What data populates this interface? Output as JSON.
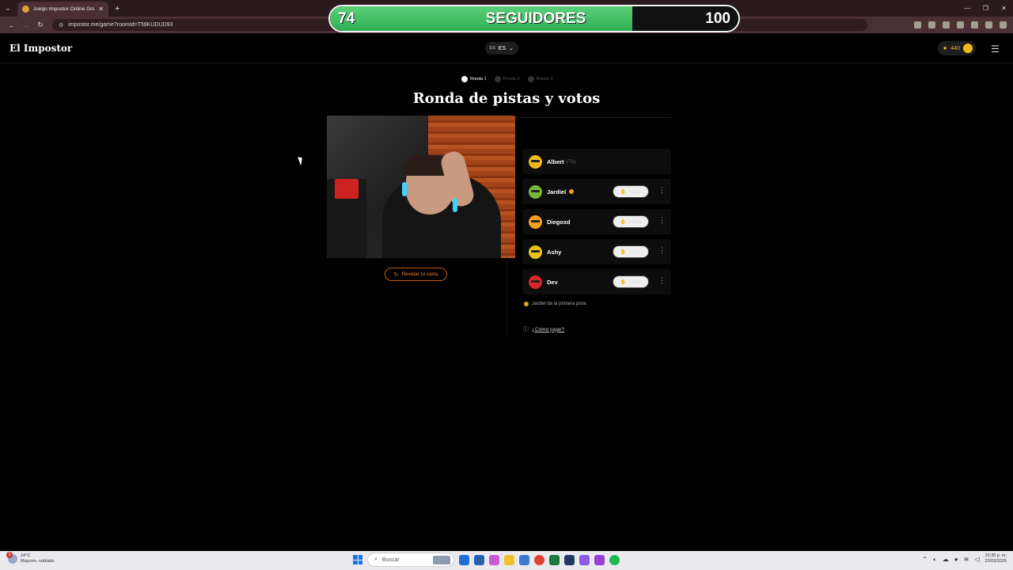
{
  "browser": {
    "tab_title": "Juego Impostor Online Gratis -",
    "url": "impostor.me/game?roomId=T59KUDUD93"
  },
  "overlay": {
    "followers_current": "74",
    "followers_label": "SEGUIDORES",
    "followers_goal": "100",
    "progress_fraction": 0.74
  },
  "header": {
    "logo": "El Impostor",
    "lang_flag": "ES",
    "lang_label": "ES",
    "coins": "440"
  },
  "rounds": [
    {
      "label": "Ronda 1",
      "active": true
    },
    {
      "label": "Ronda 2",
      "active": false
    },
    {
      "label": "Ronda 3",
      "active": false
    }
  ],
  "page_title": "Ronda de pistas y votos",
  "reveal_button": "Revelar tu carta",
  "players": [
    {
      "name": "Albert",
      "you": "(Tú)",
      "color": "#f0b81f",
      "turn": false,
      "can_vote": false
    },
    {
      "name": "Jardiel",
      "you": "",
      "color": "#7ab83a",
      "turn": true,
      "can_vote": true
    },
    {
      "name": "Diegoxd",
      "you": "",
      "color": "#f0a020",
      "turn": false,
      "can_vote": true
    },
    {
      "name": "Ashy",
      "you": "",
      "color": "#e8c21a",
      "turn": false,
      "can_vote": true
    },
    {
      "name": "Dev",
      "you": "",
      "color": "#d8262a",
      "turn": false,
      "can_vote": true
    }
  ],
  "vote_label": "Votar",
  "status_text": "Jardiel da la primera pista",
  "how_to_play": "¿Cómo jugar?",
  "taskbar": {
    "weather_temp": "24°C",
    "weather_desc": "Mayorm. nublado",
    "weather_badge": "3",
    "search_placeholder": "Buscar",
    "time": "10:39 p. m.",
    "date": "23/03/2026"
  }
}
